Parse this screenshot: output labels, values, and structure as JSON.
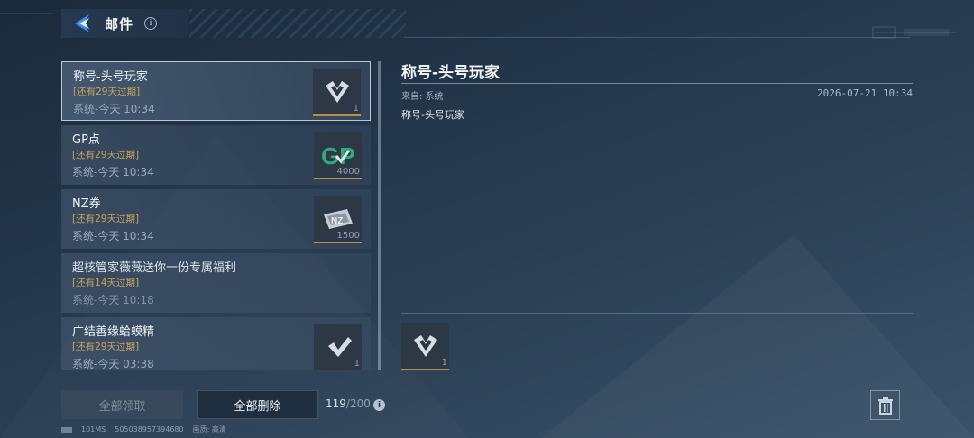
{
  "header": {
    "title": "邮件",
    "info_glyph": "i",
    "back_icon": "back-arrow-icon"
  },
  "mails": [
    {
      "title": "称号-头号玩家",
      "expire": "[还有29天过期]",
      "time": "系统-今天 10:34",
      "qty": "1",
      "thumb": "title-badge-icon",
      "selected": true,
      "read": false
    },
    {
      "title": "GP点",
      "expire": "[还有29天过期]",
      "time": "系统-今天 10:34",
      "qty": "4000",
      "thumb": "gp-coin-icon",
      "selected": false,
      "read": false
    },
    {
      "title": "NZ券",
      "expire": "[还有29天过期]",
      "time": "系统-今天 10:34",
      "qty": "1500",
      "thumb": "nz-ticket-icon",
      "selected": false,
      "read": false
    },
    {
      "title": "超核管家薇薇送你一份专属福利",
      "expire": "[还有14天过期]",
      "time": "系统-今天 10:18",
      "qty": "",
      "thumb": "",
      "selected": false,
      "read": true
    },
    {
      "title": "广结善缘蛤蟆精",
      "expire": "[还有29天过期]",
      "time": "系统-今天 03:38",
      "qty": "1",
      "thumb": "title-badge-icon",
      "selected": false,
      "read": false
    }
  ],
  "detail": {
    "title": "称号-头号玩家",
    "from": "来自: 系统",
    "date": "2026-07-21 10:34",
    "body": "称号-头号玩家",
    "attachment_qty": "1"
  },
  "footer": {
    "claim_all": "全部领取",
    "delete_all": "全部删除",
    "count": "119",
    "max": "/200",
    "info_glyph": "i"
  },
  "status": {
    "ping": "101MS",
    "id": "505038957394680",
    "quality": "画质: 高清"
  },
  "colors": {
    "accent_blue": "#3d8bff",
    "expire": "#c9a35a",
    "rarity": "#b98f44"
  }
}
